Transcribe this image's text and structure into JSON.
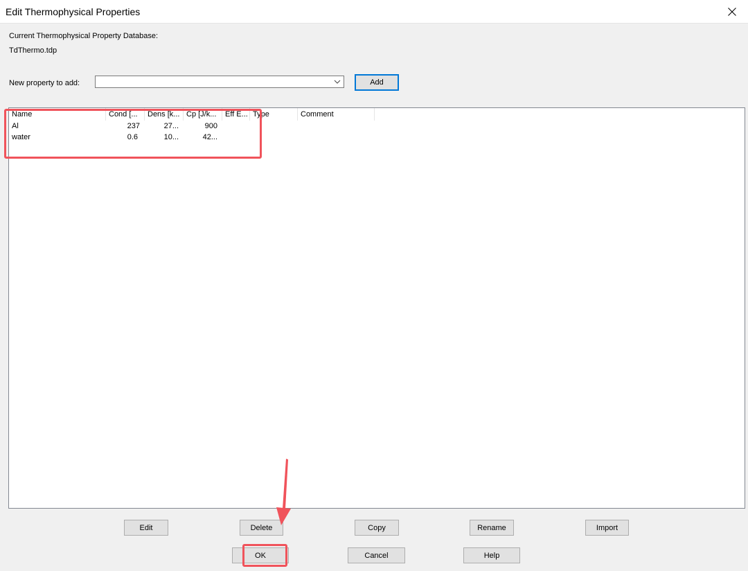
{
  "window": {
    "title": "Edit Thermophysical Properties",
    "close_icon": "close-icon"
  },
  "database": {
    "label": "Current Thermophysical Property Database:",
    "file": "TdThermo.tdp"
  },
  "add_property": {
    "label": "New property to add:",
    "selected_value": "",
    "button_label": "Add"
  },
  "table": {
    "columns": [
      "Name",
      "Cond [...",
      "Dens [k...",
      "Cp [J/k...",
      "Eff E...",
      "Type",
      "Comment"
    ],
    "rows": [
      {
        "name": "Al",
        "cond": "237",
        "dens": "27...",
        "cp": "900",
        "eff": "",
        "type": "",
        "comment": ""
      },
      {
        "name": "water",
        "cond": "0.6",
        "dens": "10...",
        "cp": "42...",
        "eff": "",
        "type": "",
        "comment": ""
      }
    ]
  },
  "buttons": {
    "edit": "Edit",
    "delete": "Delete",
    "copy": "Copy",
    "rename": "Rename",
    "import": "Import",
    "ok": "OK",
    "cancel": "Cancel",
    "help": "Help"
  },
  "annotation_color": "#f0535b"
}
